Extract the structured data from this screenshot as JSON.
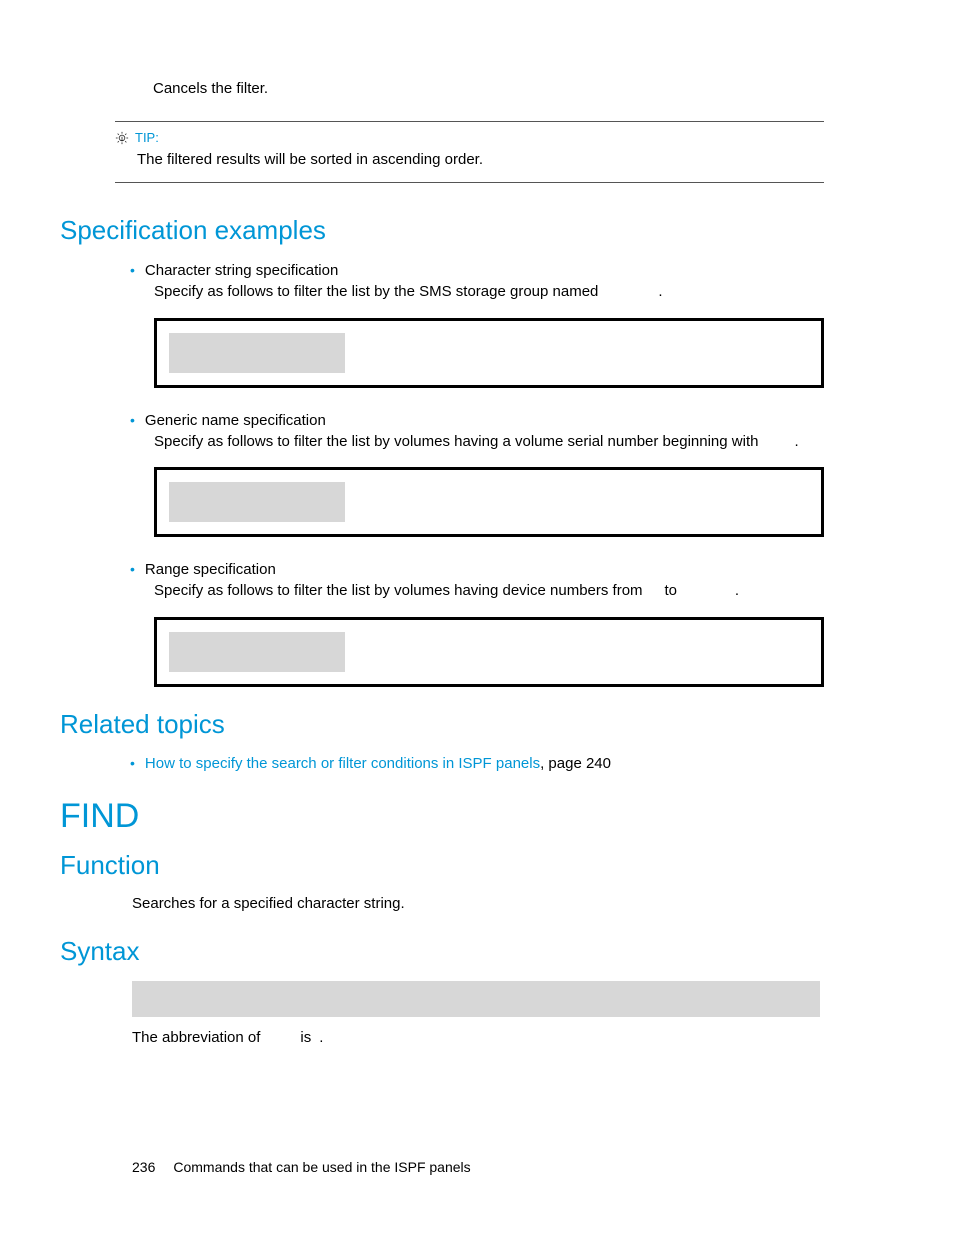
{
  "cancel_text": "Cancels the filter.",
  "tip": {
    "label": "TIP:",
    "body": "The filtered results will be sorted in ascending order."
  },
  "spec_examples": {
    "heading": "Specification examples",
    "items": [
      {
        "title": "Character string specification",
        "desc_pre": "Specify as follows to filter the list by the SMS storage group named",
        "desc_post": "."
      },
      {
        "title": "Generic name specification",
        "desc_pre": "Specify as follows to filter the list by volumes having a volume serial number beginning with",
        "desc_post": "."
      },
      {
        "title": "Range specification",
        "desc_pre": "Specify as follows to filter the list by volumes having device numbers from",
        "desc_mid": "to",
        "desc_post": "."
      }
    ]
  },
  "related": {
    "heading": "Related topics",
    "link_text": "How to specify the search or filter conditions in ISPF panels",
    "page_text": ", page 240"
  },
  "find": {
    "heading": "FIND",
    "function_heading": "Function",
    "function_body": "Searches for a specified character string.",
    "syntax_heading": "Syntax",
    "abbrev_pre": "The abbreviation of",
    "abbrev_mid": "is",
    "abbrev_post": "."
  },
  "footer": {
    "page": "236",
    "text": "Commands that can be used in the ISPF panels"
  }
}
